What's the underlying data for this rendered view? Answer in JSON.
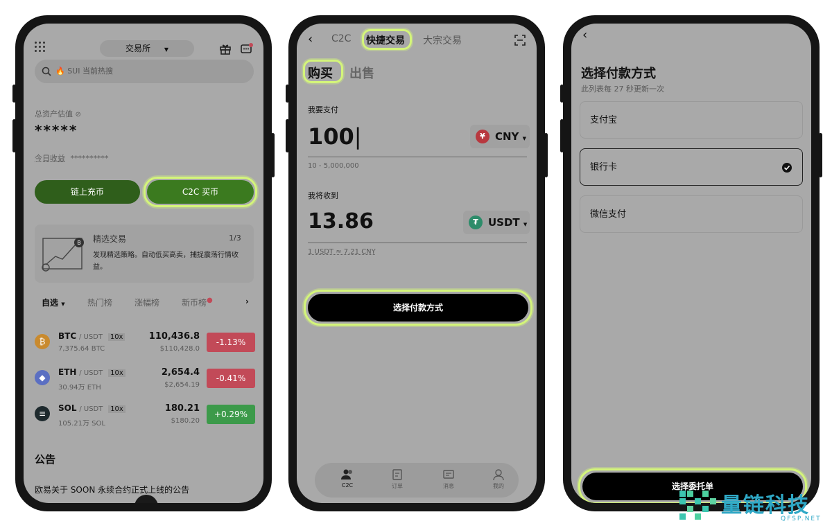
{
  "phone1": {
    "exchange_label": "交易所",
    "search_placeholder": "🔥 SUI 当前热搜",
    "asset_label": "总资产估值",
    "asset_value": "*****",
    "today_label": "今日收益",
    "today_value": "**********",
    "onchain_button": "链上充币",
    "c2c_button": "C2C 买币",
    "card": {
      "title": "精选交易",
      "page": "1/3",
      "desc": "发现精选策略。自动低买高卖，捕捉震荡行情收益。"
    },
    "tabs": [
      "自选",
      "热门榜",
      "涨幅榜",
      "新币榜"
    ],
    "coins": [
      {
        "symbol": "BTC",
        "pair": "/ USDT",
        "lev": "10x",
        "vol": "7,375.64 BTC",
        "price": "110,436.8",
        "fiat": "$110,428.0",
        "change": "-1.13%",
        "up": false,
        "logo_color": "#c98a2e"
      },
      {
        "symbol": "ETH",
        "pair": "/ USDT",
        "lev": "10x",
        "vol": "30.94万 ETH",
        "price": "2,654.4",
        "fiat": "$2,654.19",
        "change": "-0.41%",
        "up": false,
        "logo_color": "#5b6fc2"
      },
      {
        "symbol": "SOL",
        "pair": "/ USDT",
        "lev": "10x",
        "vol": "105.21万 SOL",
        "price": "180.21",
        "fiat": "$180.20",
        "change": "+0.29%",
        "up": true,
        "logo_color": "#1e2a2e"
      }
    ],
    "announce_title": "公告",
    "announce_text": "欧易关于 SOON 永续合约正式上线的公告"
  },
  "phone2": {
    "tabs": [
      "C2C",
      "快捷交易",
      "大宗交易"
    ],
    "buy_label": "购买",
    "sell_label": "出售",
    "pay_label": "我要支付",
    "pay_amount": "100",
    "pay_currency": "CNY",
    "pay_range": "10 - 5,000,000",
    "receive_label": "我将收到",
    "receive_amount": "13.86",
    "receive_currency": "USDT",
    "rate": "1 USDT ≈ 7.21 CNY",
    "select_button": "选择付款方式",
    "nav": [
      "C2C",
      "订单",
      "消息",
      "我的"
    ]
  },
  "phone3": {
    "title": "选择付款方式",
    "subtitle": "此列表每 27 秒更新一次",
    "options": [
      "支付宝",
      "银行卡",
      "微信支付"
    ],
    "selected_index": 1,
    "bottom_button": "选择委托单"
  },
  "watermark": {
    "brand": "量链科技",
    "domain": "QFSP.NET"
  },
  "colors": {
    "green": "#3b7a1f",
    "red": "#c24a58",
    "up_green": "#3c9a4a",
    "highlight": "#d4f57a"
  }
}
